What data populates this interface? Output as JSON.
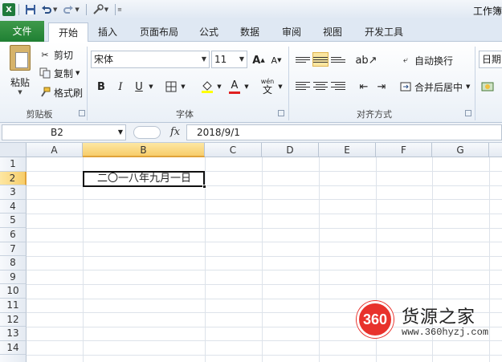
{
  "title_bar": {
    "window_title": "工作簿"
  },
  "tabs": [
    {
      "label": "文件"
    },
    {
      "label": "开始"
    },
    {
      "label": "插入"
    },
    {
      "label": "页面布局"
    },
    {
      "label": "公式"
    },
    {
      "label": "数据"
    },
    {
      "label": "审阅"
    },
    {
      "label": "视图"
    },
    {
      "label": "开发工具"
    }
  ],
  "ribbon": {
    "clipboard": {
      "paste": "粘贴",
      "cut": "剪切",
      "copy": "复制",
      "painter": "格式刷",
      "group": "剪贴板"
    },
    "font": {
      "name": "宋体",
      "size": "11",
      "bold": "B",
      "italic": "I",
      "underline": "U",
      "group": "字体",
      "grow": "A",
      "shrink": "A",
      "color_letter": "A",
      "wen": "wén"
    },
    "alignment": {
      "wrap": "自动换行",
      "merge": "合并后居中",
      "group": "对齐方式"
    },
    "number": {
      "format": "日期"
    }
  },
  "formula_bar": {
    "cell_ref": "B2",
    "fx": "fx",
    "content": "2018/9/1"
  },
  "sheet": {
    "columns": [
      "A",
      "B",
      "C",
      "D",
      "E",
      "F",
      "G"
    ],
    "rows": [
      "1",
      "2",
      "3",
      "4",
      "5",
      "6",
      "7",
      "8",
      "9",
      "10",
      "11",
      "12",
      "13",
      "14"
    ],
    "active_value": "二〇一八年九月一日"
  },
  "watermark": {
    "badge": "360",
    "brand": "货源之家",
    "url": "www.360hyzj.com"
  },
  "colors": {
    "file_tab": "#1f7f33",
    "selection": "#f7cd6a",
    "badge": "#e8322c"
  }
}
